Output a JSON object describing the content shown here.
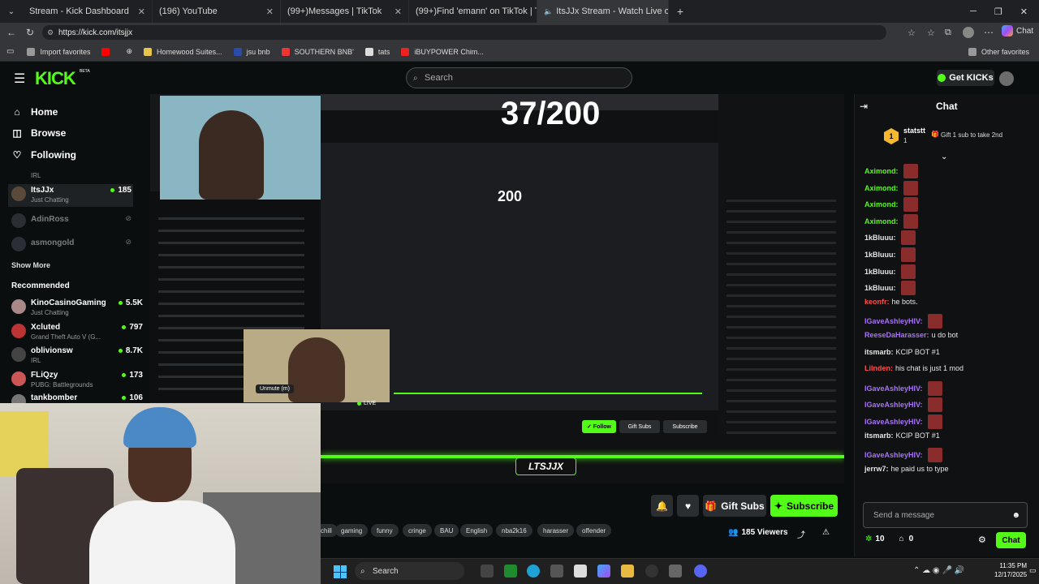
{
  "tabs": [
    {
      "title": "Stream - Kick Dashboard",
      "icon": "kick-icon"
    },
    {
      "title": "(196) YouTube",
      "icon": "youtube-icon"
    },
    {
      "title": "(99+)Messages | TikTok",
      "icon": "tiktok-icon"
    },
    {
      "title": "(99+)Find 'emann' on TikTok | Tik",
      "icon": "tiktok-icon"
    },
    {
      "title": "ItsJJx Stream - Watch Live on",
      "icon": "kick-icon",
      "active": true
    }
  ],
  "url": "https://kick.com/itsjjx",
  "bookmarks": [
    "Import favorites",
    "Homewood Suites...",
    "jsu bnb",
    "SOUTHERN BNB'",
    "tats",
    "iBUYPOWER Chim..."
  ],
  "other_favorites": "Other favorites",
  "header": {
    "logo": "KICK",
    "logo_badge": "BETA",
    "search_placeholder": "Search",
    "get_kicks": "Get KICKs"
  },
  "sidebar": {
    "nav": [
      {
        "label": "Home",
        "icon": "home-icon"
      },
      {
        "label": "Browse",
        "icon": "browse-icon"
      },
      {
        "label": "Following",
        "icon": "heart-icon"
      }
    ],
    "following": [
      {
        "name": "",
        "category": "IRL",
        "viewers": ""
      },
      {
        "name": "ItsJJx",
        "category": "Just Chatting",
        "viewers": "185"
      },
      {
        "name": "AdinRoss",
        "category": "",
        "viewers": ""
      },
      {
        "name": "asmongold",
        "category": "",
        "viewers": ""
      }
    ],
    "show_more": "Show More",
    "recommended_title": "Recommended",
    "recommended": [
      {
        "name": "KinoCasinoGaming",
        "category": "Just Chatting",
        "viewers": "5.5K"
      },
      {
        "name": "Xcluted",
        "category": "Grand Theft Auto V (G...",
        "viewers": "797"
      },
      {
        "name": "oblivionsw",
        "category": "IRL",
        "viewers": "8.7K"
      },
      {
        "name": "FLiQzy",
        "category": "PUBG: Battlegrounds",
        "viewers": "173"
      },
      {
        "name": "tankbomber",
        "category": "",
        "viewers": "106"
      }
    ]
  },
  "video": {
    "goal_text": "37/200",
    "inner_goal": "200",
    "unmute_label": "Unmute (m)",
    "live_label": "LIVE",
    "watermark": "LTSJJX"
  },
  "below_video": {
    "gift_subs": "Gift Subs",
    "subscribe": "Subscribe",
    "tags": [
      "chill",
      "gaming",
      "funny",
      "cringe",
      "BAU",
      "English",
      "nba2k16",
      "harasser",
      "offender"
    ],
    "viewers": "185 Viewers"
  },
  "chat": {
    "title": "Chat",
    "pinned_user": "statstt",
    "pinned_rank": "1",
    "pinned_text": "Gift 1 sub to take 2nd",
    "messages": [
      {
        "user": "Aximond:",
        "text": "",
        "color": "#53fc18",
        "emote": true
      },
      {
        "user": "Aximond:",
        "text": "",
        "color": "#53fc18",
        "emote": true
      },
      {
        "user": "Aximond:",
        "text": "",
        "color": "#53fc18",
        "emote": true
      },
      {
        "user": "Aximond:",
        "text": "",
        "color": "#53fc18",
        "emote": true
      },
      {
        "user": "1kBluuu:",
        "text": "",
        "color": "#e6e6e6",
        "emote": true
      },
      {
        "user": "1kBluuu:",
        "text": "",
        "color": "#e6e6e6",
        "emote": true
      },
      {
        "user": "1kBluuu:",
        "text": "",
        "color": "#e6e6e6",
        "emote": true
      },
      {
        "user": "1kBluuu:",
        "text": "",
        "color": "#e6e6e6",
        "emote": true
      },
      {
        "user": "keonfr:",
        "text": "he bots.",
        "color": "#ff4d4d",
        "emote": false
      },
      {
        "user": "IGaveAshleyHIV:",
        "text": "",
        "color": "#a872f7",
        "emote": true
      },
      {
        "user": "ReeseDaHarasser:",
        "text": "u do bot",
        "color": "#a872f7",
        "emote": false
      },
      {
        "user": "itsmarb:",
        "text": "KCIP BOT #1",
        "color": "#e6e6e6",
        "emote": false
      },
      {
        "user": "Lilnden:",
        "text": "his chat is just 1 mod",
        "color": "#ff4d4d",
        "emote": false
      },
      {
        "user": "IGaveAshleyHIV:",
        "text": "",
        "color": "#a872f7",
        "emote": true
      },
      {
        "user": "IGaveAshleyHIV:",
        "text": "",
        "color": "#a872f7",
        "emote": true
      },
      {
        "user": "IGaveAshleyHIV:",
        "text": "",
        "color": "#a872f7",
        "emote": true
      },
      {
        "user": "itsmarb:",
        "text": "KCIP BOT #1",
        "color": "#e6e6e6",
        "emote": false
      },
      {
        "user": "IGaveAshleyHIV:",
        "text": "",
        "color": "#a872f7",
        "emote": true
      },
      {
        "user": "jerrw7:",
        "text": "he paid us to type",
        "color": "#e6e6e6",
        "emote": false
      }
    ],
    "input_placeholder": "Send a message",
    "points": "10",
    "other_count": "0",
    "send_label": "Chat"
  },
  "taskbar": {
    "search": "Search",
    "time": "11:35 PM",
    "date": "12/17/2025"
  },
  "colors": {
    "accent": "#53fc18",
    "bg": "#0b0e0f"
  }
}
